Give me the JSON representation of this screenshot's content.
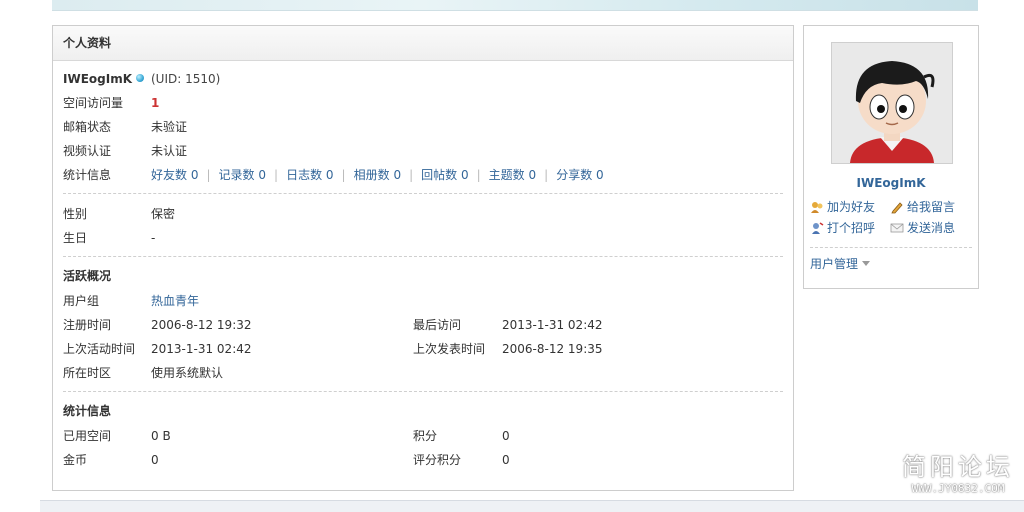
{
  "panel_title": "个人资料",
  "profile": {
    "username": "IWEogImK",
    "uid": "(UID: 1510)",
    "visits_label": "空间访问量",
    "visits_value": "1",
    "email_label": "邮箱状态",
    "email_value": "未验证",
    "video_label": "视频认证",
    "video_value": "未认证",
    "stats_label": "统计信息",
    "stats": [
      {
        "label": "好友数",
        "value": "0"
      },
      {
        "label": "记录数",
        "value": "0"
      },
      {
        "label": "日志数",
        "value": "0"
      },
      {
        "label": "相册数",
        "value": "0"
      },
      {
        "label": "回帖数",
        "value": "0"
      },
      {
        "label": "主题数",
        "value": "0"
      },
      {
        "label": "分享数",
        "value": "0"
      }
    ]
  },
  "personal": {
    "gender_label": "性别",
    "gender_value": "保密",
    "birthday_label": "生日",
    "birthday_value": "-"
  },
  "activity": {
    "title": "活跃概况",
    "group_label": "用户组",
    "group_value": "热血青年",
    "register_label": "注册时间",
    "register_value": "2006-8-12 19:32",
    "last_visit_label": "最后访问",
    "last_visit_value": "2013-1-31 02:42",
    "last_active_label": "上次活动时间",
    "last_active_value": "2013-1-31 02:42",
    "last_post_label": "上次发表时间",
    "last_post_value": "2006-8-12 19:35",
    "timezone_label": "所在时区",
    "timezone_value": "使用系统默认"
  },
  "statistics": {
    "title": "统计信息",
    "space_label": "已用空间",
    "space_value": "0 B",
    "points_label": "积分",
    "points_value": "0",
    "gold_label": "金币",
    "gold_value": "0",
    "rating_label": "评分积分",
    "rating_value": "0"
  },
  "sidebar": {
    "username": "IWEogImK",
    "add_friend": "加为好友",
    "leave_message": "给我留言",
    "greet": "打个招呼",
    "send_message": "发送消息",
    "user_manage": "用户管理"
  },
  "watermark": {
    "title": "简阳论坛",
    "url": "WWW.JY0832.COM"
  },
  "colors": {
    "link": "#336699",
    "highlight": "#cc3333",
    "border": "#cdcdcd"
  }
}
